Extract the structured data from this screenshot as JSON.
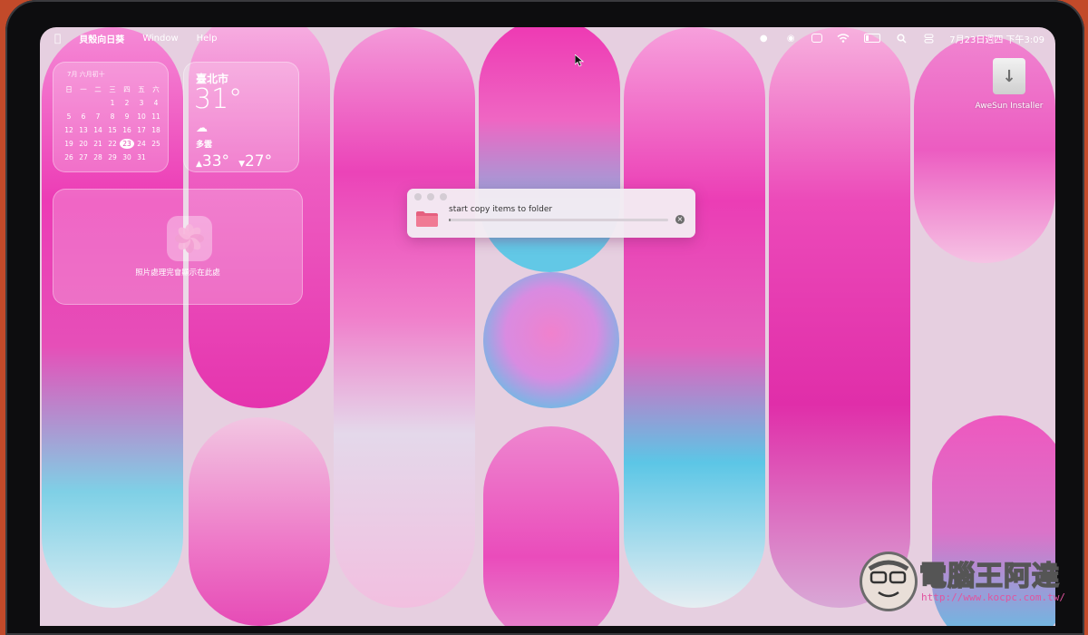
{
  "menubar": {
    "app_name": "貝殼向日葵",
    "menus": [
      "Window",
      "Help"
    ],
    "datetime": "7月23日週四  下午3:09"
  },
  "calendar_widget": {
    "header": "7月  六月初十",
    "weekdays": [
      "日",
      "一",
      "二",
      "三",
      "四",
      "五",
      "六"
    ],
    "days": [
      "",
      "",
      "",
      "1",
      "2",
      "3",
      "4",
      "5",
      "6",
      "7",
      "8",
      "9",
      "10",
      "11",
      "12",
      "13",
      "14",
      "15",
      "16",
      "17",
      "18",
      "19",
      "20",
      "21",
      "22",
      "23",
      "24",
      "25",
      "26",
      "27",
      "28",
      "29",
      "30",
      "31",
      ""
    ],
    "today": "23"
  },
  "weather_widget": {
    "city": "臺北市",
    "temperature": "31°",
    "condition": "多雲",
    "high": "33°",
    "low": "27°"
  },
  "photos_widget": {
    "text": "照片處理完會顯示在此處"
  },
  "desktop_icon": {
    "label": "AweSun Installer"
  },
  "copy_dialog": {
    "title": "start copy items to folder",
    "progress": 0.01
  },
  "watermark": {
    "title": "電腦王阿達",
    "url": "http://www.kocpc.com.tw/"
  }
}
